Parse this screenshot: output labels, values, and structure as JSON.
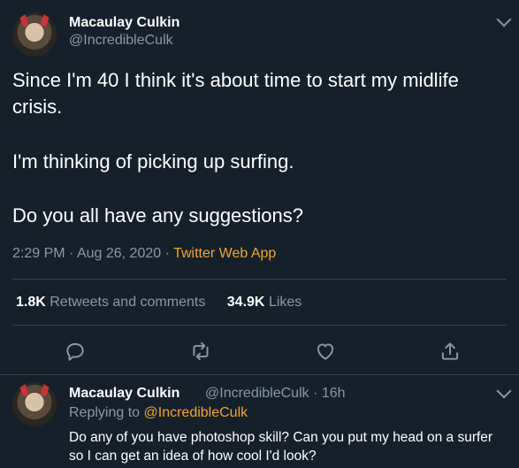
{
  "tweet": {
    "author_name": "Macaulay Culkin",
    "author_handle": "@IncredibleCulk",
    "text_lines": [
      "Since I'm 40 I think it's about time to start my midlife",
      "crisis.",
      "I'm thinking of picking up surfing.",
      "Do you all have any suggestions?"
    ],
    "time": "2:29 PM",
    "date": "Aug 26, 2020",
    "app": "Twitter Web App",
    "retweets_count": "1.8K",
    "retweets_label": "Retweets and comments",
    "likes_count": "34.9K",
    "likes_label": "Likes"
  },
  "actions": [
    "reply-icon",
    "retweet-icon",
    "like-icon",
    "share-icon"
  ],
  "reply": {
    "author_name": "Macaulay Culkin",
    "author_handle": "@IncredibleCulk",
    "age": "16h",
    "replying_prefix": "Replying to",
    "replying_to": "@IncredibleCulk",
    "text_lines": [
      "Do any of you have photoshop skill? Can you put my head on a surfer",
      "so I can get an idea of how cool I'd look?"
    ]
  },
  "colors": {
    "background": "#15202b",
    "muted": "#8899a6",
    "accent": "#f3a527",
    "divider": "#38444d"
  }
}
